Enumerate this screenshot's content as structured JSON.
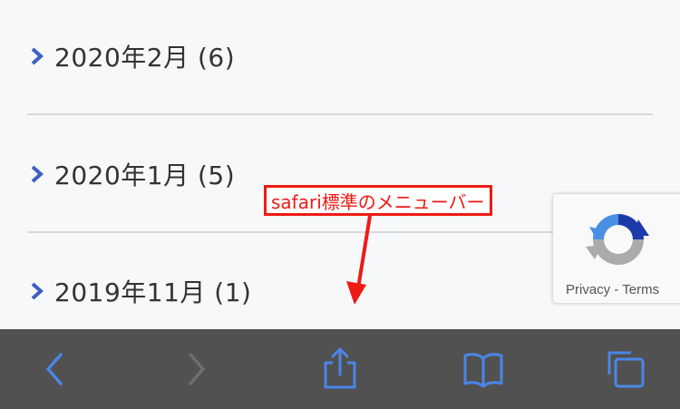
{
  "archive": {
    "items": [
      {
        "label": "2020年2月 (6)"
      },
      {
        "label": "2020年1月 (5)"
      },
      {
        "label": "2019年11月 (1)"
      }
    ],
    "chevron_icon": "chevron-right-icon",
    "accent_color": "#3d5fc4"
  },
  "annotation": {
    "text": "safari標準のメニューバー",
    "color": "#ef1a14"
  },
  "recaptcha": {
    "privacy": "Privacy",
    "separator": "-",
    "terms": "Terms"
  },
  "toolbar": {
    "background": "#515151",
    "icon_color": "#4a86e8",
    "buttons": [
      "back-icon",
      "forward-icon",
      "share-icon",
      "bookmarks-icon",
      "tabs-icon"
    ]
  }
}
